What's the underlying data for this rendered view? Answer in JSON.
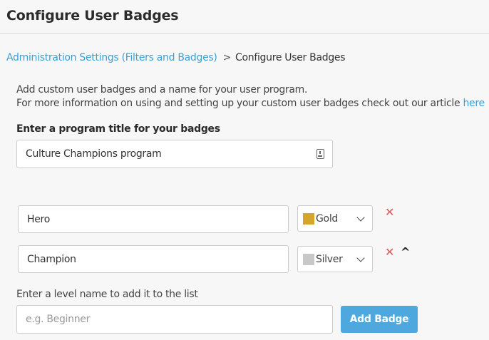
{
  "header": {
    "title": "Configure User Badges"
  },
  "breadcrumb": {
    "parent_label": "Administration Settings (Filters and Badges)",
    "separator": ">",
    "current_label": "Configure User Badges"
  },
  "intro": {
    "line1": "Add custom user badges and a name for your user program.",
    "line2_text": "For more information on using and setting up your custom user badges check out our article ",
    "line2_link": "here"
  },
  "program": {
    "label": "Enter a program title for your badges",
    "value": "Culture Champions program",
    "icon": "clipboard-icon"
  },
  "badges": [
    {
      "name": "Hero",
      "color_label": "Gold",
      "color_hex": "#d4a72c",
      "remove_icon": "✕"
    },
    {
      "name": "Champion",
      "color_label": "Silver",
      "color_hex": "#c8c8c8",
      "remove_icon": "✕",
      "move_up_icon": "^"
    }
  ],
  "add_level": {
    "label": "Enter a level name to add it to the list",
    "placeholder": "e.g. Beginner",
    "button_label": "Add Badge"
  },
  "colors": {
    "accent": "#4fa8dd",
    "link": "#3d9fd6",
    "remove": "#e05555"
  }
}
